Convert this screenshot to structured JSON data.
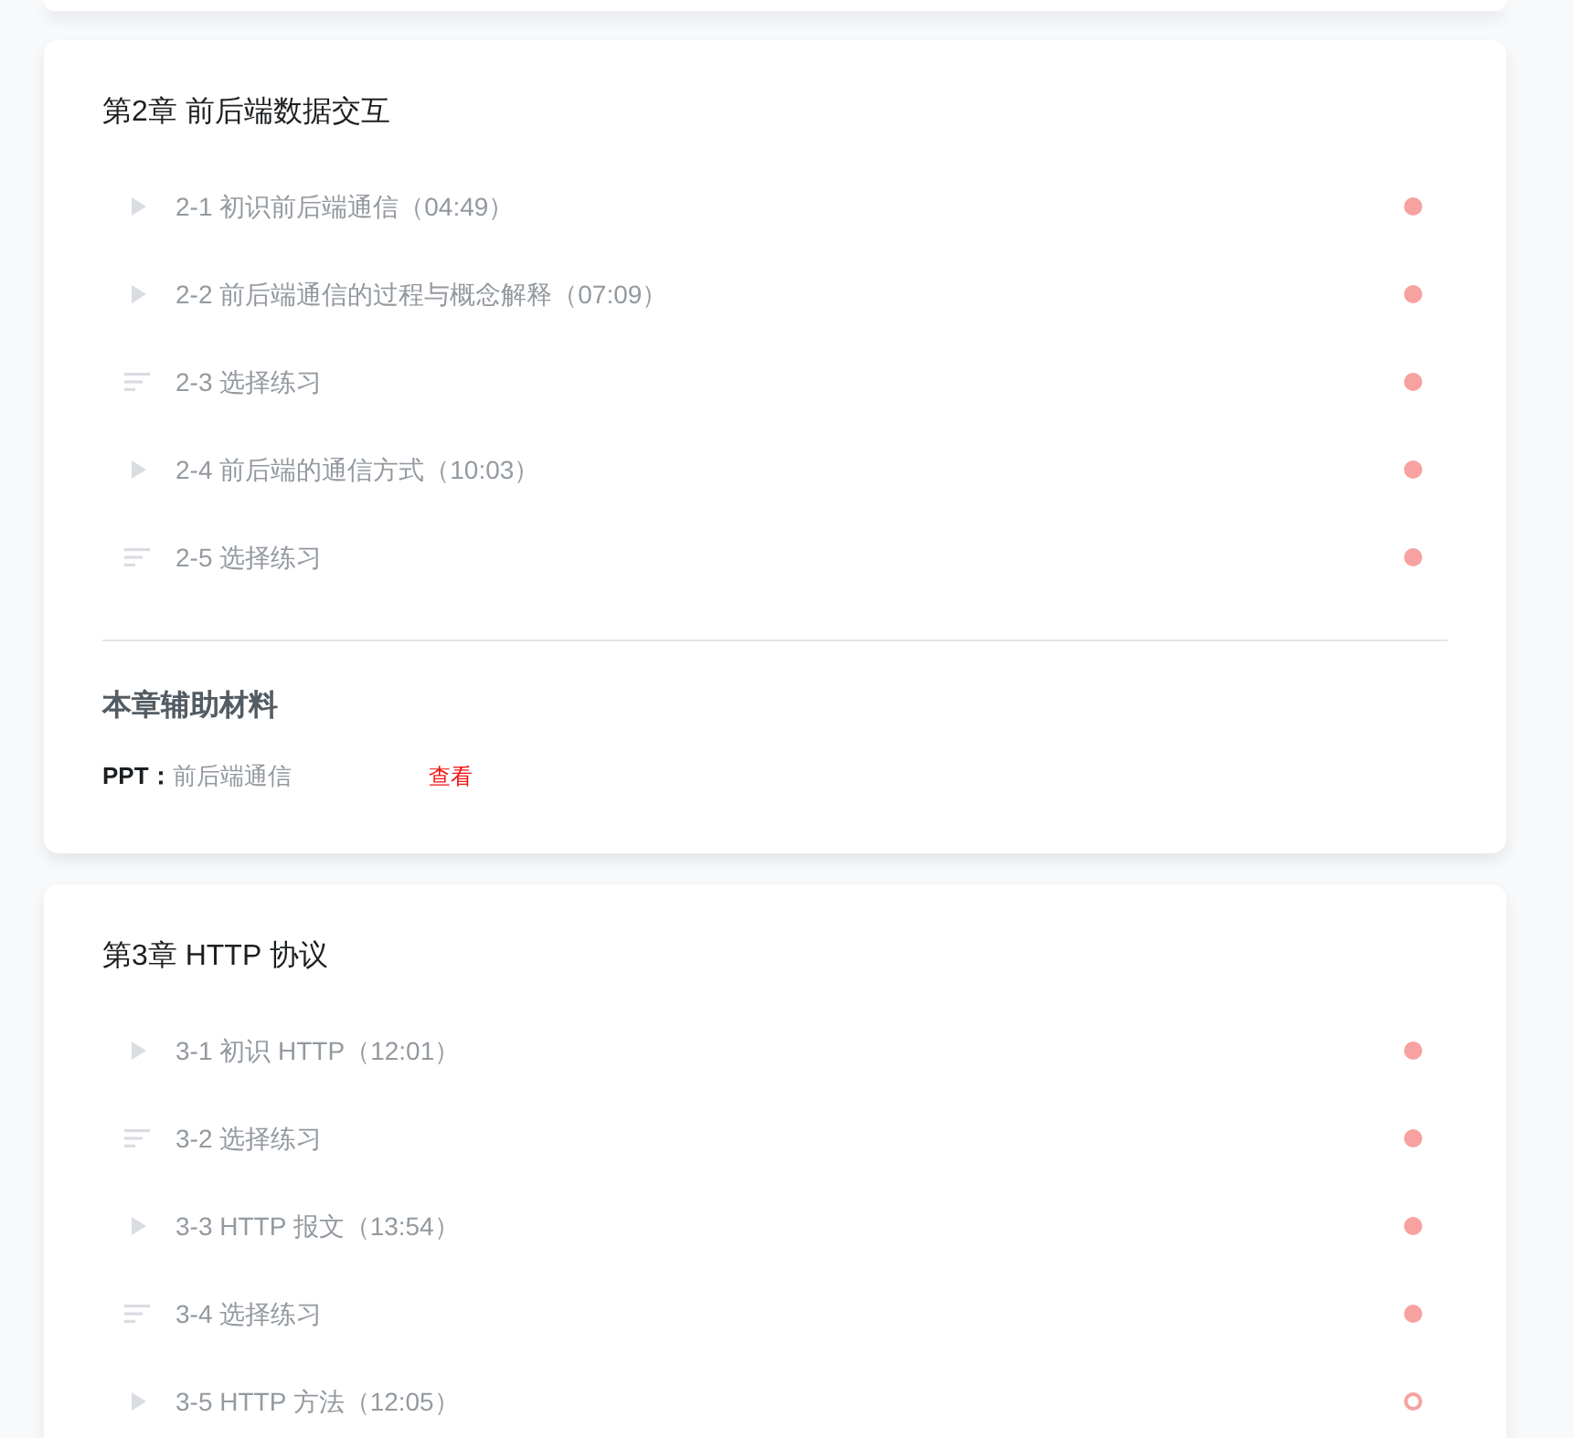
{
  "chapters": [
    {
      "title": "第2章 前后端数据交互",
      "lessons": [
        {
          "kind": "video",
          "label": "2-1 初识前后端通信（04:49）",
          "completed": true
        },
        {
          "kind": "video",
          "label": "2-2 前后端通信的过程与概念解释（07:09）",
          "completed": true
        },
        {
          "kind": "exercise",
          "label": "2-3 选择练习",
          "completed": true
        },
        {
          "kind": "video",
          "label": "2-4 前后端的通信方式（10:03）",
          "completed": true
        },
        {
          "kind": "exercise",
          "label": "2-5 选择练习",
          "completed": true
        }
      ],
      "materials": {
        "heading": "本章辅助材料",
        "items": [
          {
            "type": "PPT：",
            "name": "前后端通信",
            "action": "查看"
          }
        ]
      }
    },
    {
      "title": "第3章 HTTP 协议",
      "lessons": [
        {
          "kind": "video",
          "label": "3-1 初识 HTTP（12:01）",
          "completed": true
        },
        {
          "kind": "exercise",
          "label": "3-2 选择练习",
          "completed": true
        },
        {
          "kind": "video",
          "label": "3-3 HTTP 报文（13:54）",
          "completed": true
        },
        {
          "kind": "exercise",
          "label": "3-4 选择练习",
          "completed": true
        },
        {
          "kind": "video",
          "label": "3-5 HTTP 方法（12:05）",
          "completed": false
        }
      ]
    }
  ]
}
